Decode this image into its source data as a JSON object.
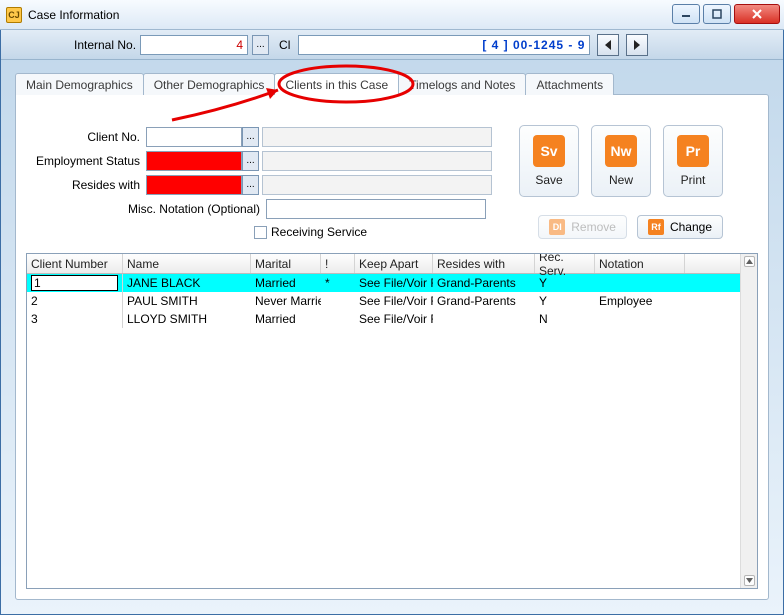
{
  "window": {
    "title": "Case Information"
  },
  "header": {
    "internal_label": "Internal No.",
    "internal_value": "4",
    "cl_label": "Cl",
    "case_display": "[ 4 ]  00-1245 - 9"
  },
  "tabs": [
    {
      "label": "Main Demographics"
    },
    {
      "label": "Other Demographics"
    },
    {
      "label": "Clients in this Case"
    },
    {
      "label": "Timelogs and Notes"
    },
    {
      "label": "Attachments"
    }
  ],
  "active_tab_index": 2,
  "form": {
    "client_no_label": "Client No.",
    "employment_label": "Employment Status",
    "resides_label": "Resides with",
    "misc_label": "Misc. Notation (Optional)",
    "receiving_label": "Receiving Service"
  },
  "actions": {
    "save": {
      "icon": "Sv",
      "label": "Save"
    },
    "new": {
      "icon": "Nw",
      "label": "New"
    },
    "print": {
      "icon": "Pr",
      "label": "Print"
    },
    "remove": {
      "icon": "Dl",
      "label": "Remove",
      "disabled": true
    },
    "change": {
      "icon": "Rf",
      "label": "Change",
      "disabled": false
    }
  },
  "table": {
    "columns": [
      "Client Number",
      "Name",
      "Marital",
      "!",
      "Keep Apart",
      "Resides with",
      "Rec. Serv.",
      "Notation"
    ],
    "rows": [
      {
        "num": "1",
        "name": "JANE BLACK",
        "marital": "Married",
        "bang": "*",
        "keep": "See File/Voir F",
        "resides": "Grand-Parents",
        "rec": "Y",
        "note": "",
        "selected": true
      },
      {
        "num": "2",
        "name": "PAUL SMITH",
        "marital": "Never Married",
        "bang": "",
        "keep": "See File/Voir F",
        "resides": "Grand-Parents",
        "rec": "Y",
        "note": "Employee",
        "selected": false
      },
      {
        "num": "3",
        "name": "LLOYD SMITH",
        "marital": "Married",
        "bang": "",
        "keep": "See File/Voir F",
        "resides": "",
        "rec": "N",
        "note": "",
        "selected": false
      }
    ]
  },
  "ellipsis": "..."
}
